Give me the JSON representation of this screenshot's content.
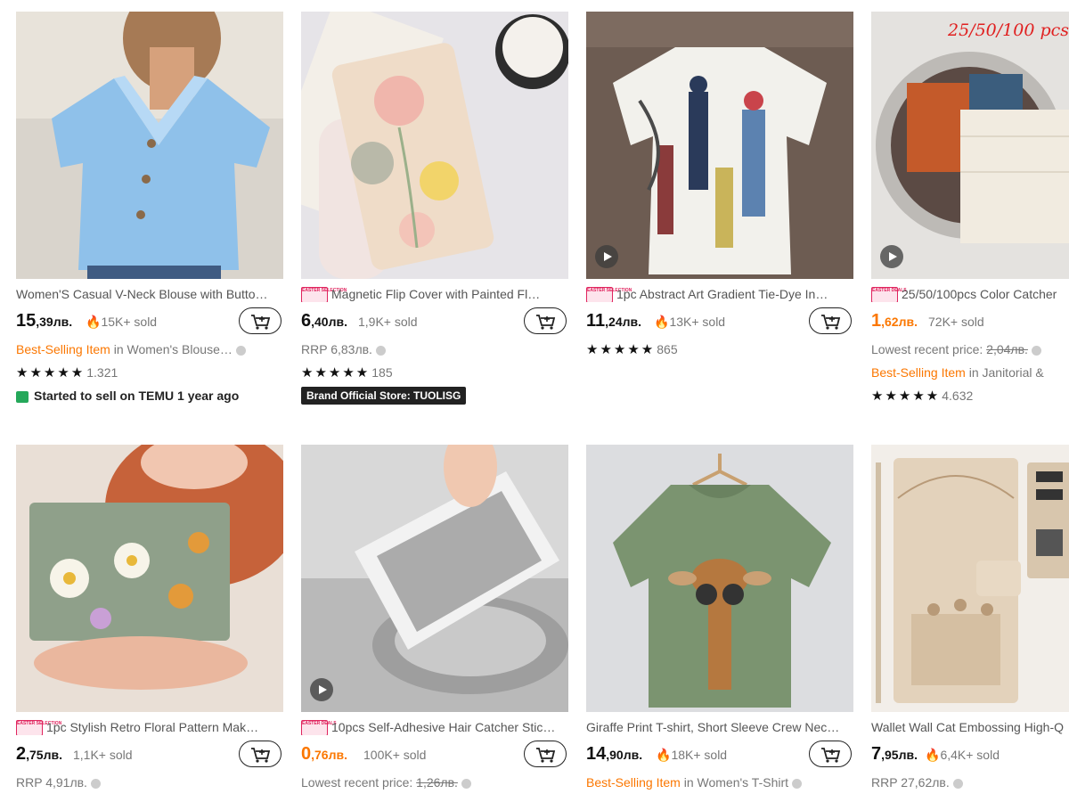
{
  "cart_label": "Add to cart",
  "row1": [
    {
      "title": "Women'S Casual V-Neck Blouse with Butto…",
      "tag": "",
      "price_int": "15",
      "price_dec": ",39лв.",
      "sold": "15K+ sold",
      "flame": true,
      "line2_prefix": "Best-Selling Item",
      "line2_suffix": " in Women's Blouse…",
      "rating_stars": "★★★★★",
      "rating_count": "1.321",
      "started": "Started to sell on TEMU 1 year ago"
    },
    {
      "title": "Magnetic Flip Cover with Painted Fl…",
      "tag": "EASTER SELECTION",
      "price_int": "6",
      "price_dec": ",40лв.",
      "sold": "1,9K+ sold",
      "flame": false,
      "rrp": "RRP 6,83лв.",
      "rating_stars": "★★★★★",
      "rating_count": "185",
      "brand_store": "Brand Official Store: TUOLISG"
    },
    {
      "title": "1pc Abstract Art Gradient Tie-Dye In…",
      "tag": "EASTER SELECTION",
      "price_int": "11",
      "price_dec": ",24лв.",
      "sold": "13K+ sold",
      "flame": true,
      "rating_stars": "★★★★★",
      "rating_count": "865"
    },
    {
      "title": "25/50/100pcs Color Catcher",
      "tag": "EASTER DEALS",
      "overlay": "25/50/100 pcs",
      "price_int": "1",
      "price_dec": ",62лв.",
      "sold": "72K+ sold",
      "flame": false,
      "lowest_label": "Lowest recent price: ",
      "lowest_value": "2,04лв.",
      "line2_prefix": "Best-Selling Item",
      "line2_suffix": " in Janitorial &",
      "rating_stars": "★★★★★",
      "rating_count": "4.632"
    }
  ],
  "row2": [
    {
      "title": "1pc Stylish Retro Floral Pattern Mak…",
      "tag": "EASTER SELECTION",
      "price_int": "2",
      "price_dec": ",75лв.",
      "sold": "1,1K+ sold",
      "flame": false,
      "rrp": "RRP 4,91лв."
    },
    {
      "title": "10pcs Self-Adhesive Hair Catcher Stic…",
      "tag": "EASTER DEALS",
      "price_int": "0",
      "price_dec": ",76лв.",
      "sold": "100K+ sold",
      "flame": false,
      "lowest_label": "Lowest recent price: ",
      "lowest_value": "1,26лв."
    },
    {
      "title": "Giraffe Print T-shirt, Short Sleeve Crew Nec…",
      "tag": "",
      "price_int": "14",
      "price_dec": ",90лв.",
      "sold": "18K+ sold",
      "flame": true,
      "line2_prefix": "Best-Selling Item",
      "line2_suffix": " in Women's T-Shirt"
    },
    {
      "title": "Wallet Wall Cat Embossing High-Q",
      "tag": "",
      "price_int": "7",
      "price_dec": ",95лв.",
      "sold": "6,4K+ sold",
      "flame": true,
      "rrp": "RRP 27,62лв."
    }
  ],
  "colors": {
    "accent_orange": "#fb7701",
    "easter_pink": "#e0245e",
    "store_green": "#25a85a"
  },
  "icons": [
    "cart-plus-icon",
    "flame-icon",
    "info-icon",
    "play-icon",
    "calendar-icon"
  ]
}
